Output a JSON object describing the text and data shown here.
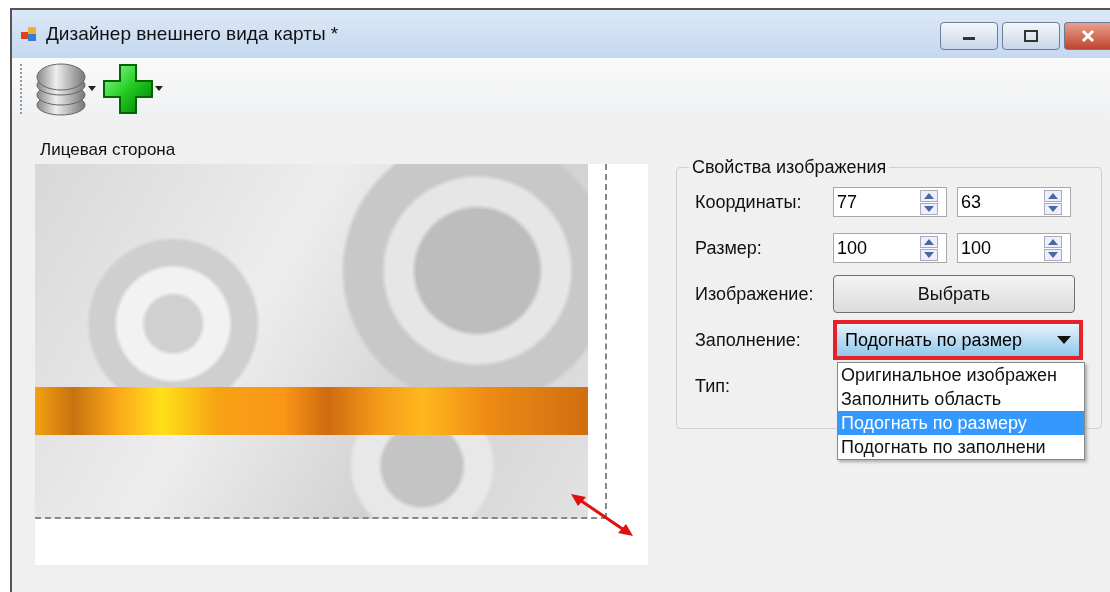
{
  "window": {
    "title": "Дизайнер внешнего вида карты *"
  },
  "toolbar": {
    "items": [
      {
        "kind": "database",
        "has_dropdown": true
      },
      {
        "kind": "add",
        "has_dropdown": true
      }
    ]
  },
  "card": {
    "label": "Лицевая сторона"
  },
  "properties": {
    "title": "Свойства изображения",
    "rows": [
      {
        "kind": "spinners",
        "label": "Координаты:",
        "values": [
          "77",
          "63"
        ]
      },
      {
        "kind": "spinners",
        "label": "Размер:",
        "values": [
          "100",
          "100"
        ]
      },
      {
        "kind": "button",
        "label": "Изображение:",
        "button": "Выбрать"
      },
      {
        "kind": "combo",
        "label": "Заполнение:",
        "value": "Подогнать по размер",
        "highlighted": true,
        "open": true,
        "options": [
          {
            "label": "Оригинальное изображен",
            "selected": false
          },
          {
            "label": "Заполнить область",
            "selected": false
          },
          {
            "label": "Подогнать по размеру",
            "selected": true
          },
          {
            "label": "Подогнать по заполнени",
            "selected": false
          }
        ]
      },
      {
        "kind": "text",
        "label": "Тип:"
      }
    ]
  }
}
